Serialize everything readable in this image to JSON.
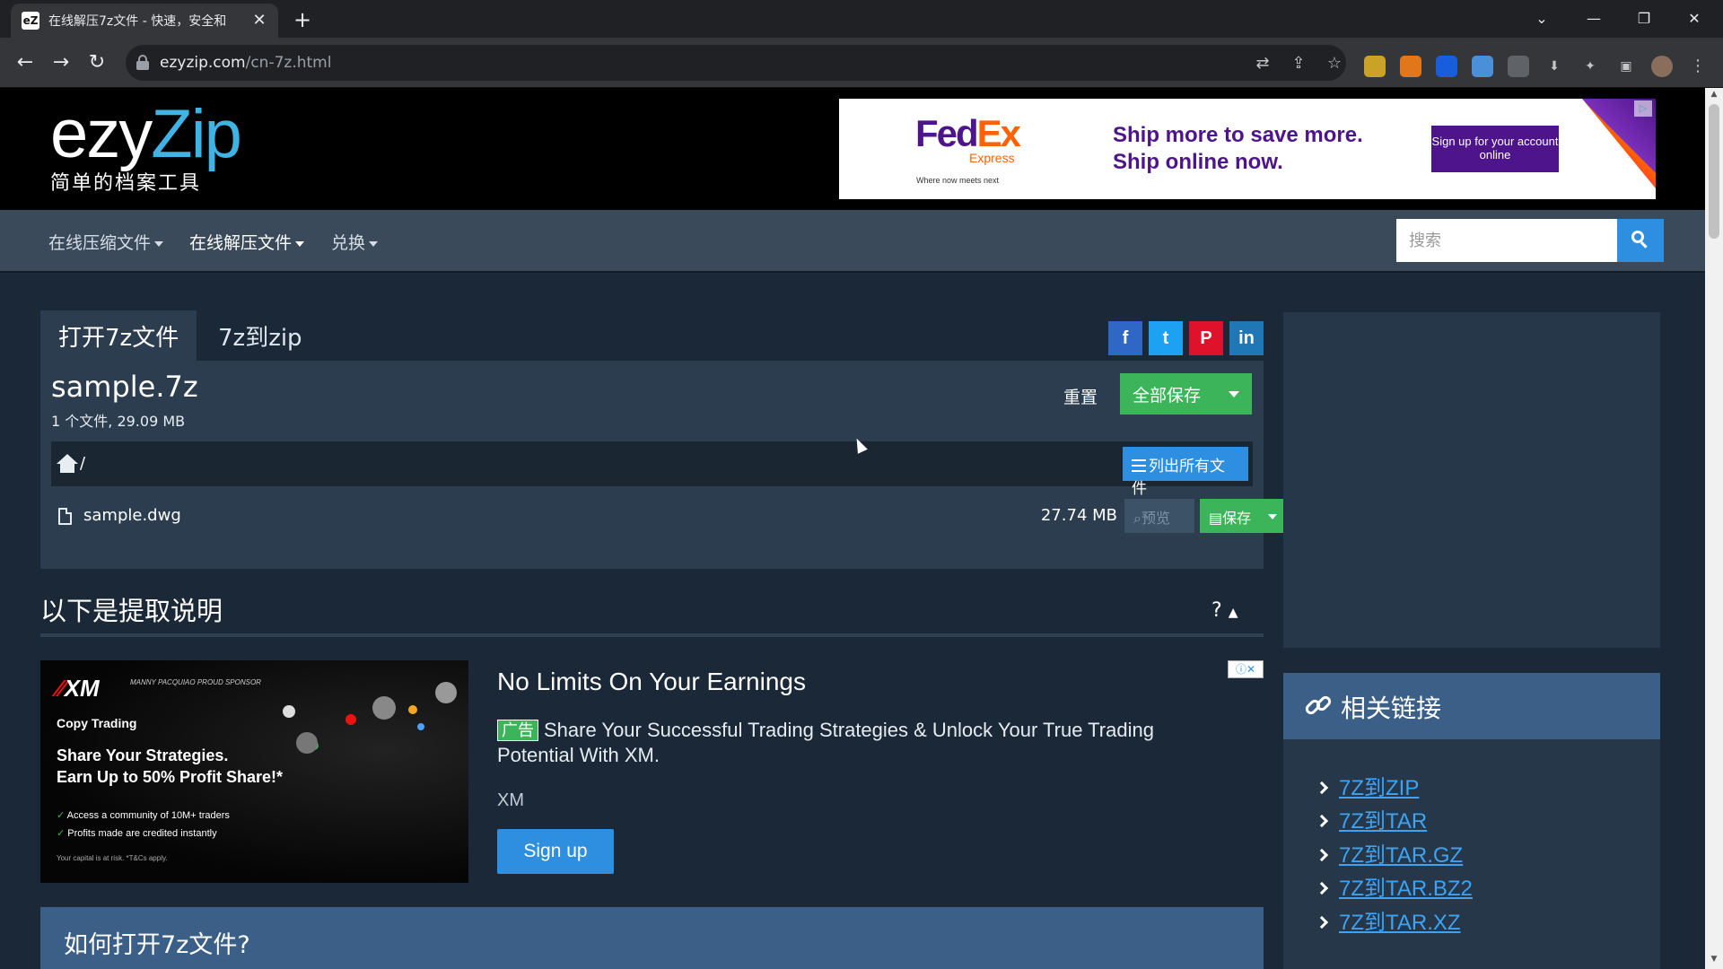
{
  "browser": {
    "tab_title": "在线解压7z文件 - 快速，安全和",
    "tab_favicon": "eZ",
    "tab_close": "✕",
    "new_tab": "+",
    "url_host": "ezyzip.com",
    "url_path": "/cn-7z.html",
    "icons": {
      "back": "←",
      "forward": "→",
      "reload": "↻",
      "translate": "⇄",
      "share": "⇪",
      "bookmark": "☆",
      "extensions": "✦",
      "sidepanel": "▣",
      "menu": "⋮",
      "minimize": "—",
      "maximize": "❐",
      "close": "✕",
      "tabs_dropdown": "⌄"
    }
  },
  "site": {
    "logo_ezy": "ezy",
    "logo_zip": "Zip",
    "logo_sub": "简单的档案工具"
  },
  "top_ad": {
    "brand_fed": "Fed",
    "brand_ex": "Ex",
    "brand_express": "Express",
    "tagline": "Where now meets next",
    "headline_line1": "Ship more to save more.",
    "headline_line2": "Ship online now.",
    "cta": "Sign up for your account online",
    "adchoice": "▷"
  },
  "nav": {
    "items": [
      {
        "label": "在线压缩文件"
      },
      {
        "label": "在线解压文件"
      },
      {
        "label": "兑换"
      }
    ],
    "search_placeholder": "搜索"
  },
  "tool": {
    "tabs": [
      {
        "label": "打开7z文件"
      },
      {
        "label": "7z到zip"
      }
    ],
    "share": {
      "facebook": "f",
      "twitter": "t",
      "pinterest": "P",
      "linkedin": "in"
    },
    "colors": {
      "facebook": "#2f67c6",
      "twitter": "#1da1f2",
      "pinterest": "#e0112b",
      "linkedin": "#2077b5"
    },
    "archive_name": "sample.7z",
    "archive_meta": "1 个文件, 29.09 MB",
    "reset": "重置",
    "save_all": "全部保存",
    "path": "/",
    "list_all": "列出所有文件",
    "files": [
      {
        "name": "sample.dwg",
        "size": "27.74 MB",
        "preview": "预览",
        "save": "保存"
      }
    ]
  },
  "instructions": {
    "title": "以下是提取说明",
    "help": "?"
  },
  "native_ad": {
    "image_brand": "XM",
    "image_sponsor": "MANNY PACQUIAO PROUD SPONSOR",
    "image_copy": "Copy Trading",
    "image_line1": "Share Your Strategies.",
    "image_line2": "Earn Up to 50% Profit Share!*",
    "image_bullet1": "Access a community of 10M+ traders",
    "image_bullet2": "Profits made are credited instantly",
    "image_footnote": "Your capital is at risk. *T&Cs apply.",
    "title": "No Limits On Your Earnings",
    "badge": "广告",
    "description": "Share Your Successful Trading Strategies & Unlock Your True Trading Potential With XM.",
    "brand": "XM",
    "cta": "Sign up",
    "adchoices": "ⓘ✕"
  },
  "howto": {
    "title": "如何打开7z文件?"
  },
  "related": {
    "title": "相关链接",
    "links": [
      {
        "label": "7Z到ZIP"
      },
      {
        "label": "7Z到TAR"
      },
      {
        "label": "7Z到TAR.GZ"
      },
      {
        "label": "7Z到TAR.BZ2"
      },
      {
        "label": "7Z到TAR.XZ"
      }
    ]
  }
}
